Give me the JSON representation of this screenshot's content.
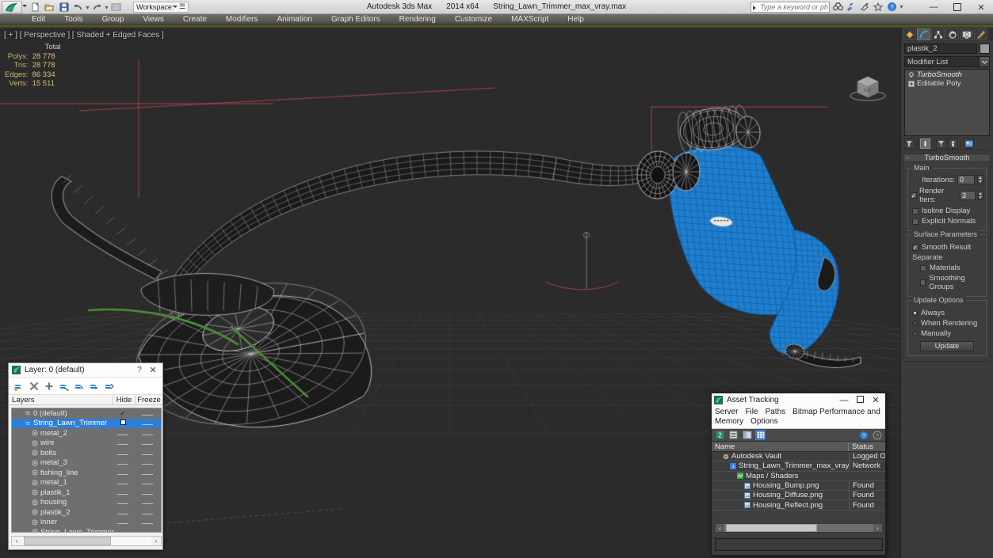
{
  "titlebar": {
    "app_title": "Autodesk 3ds Max",
    "version": "2014 x64",
    "file_name": "String_Lawn_Trimmer_max_vray.max",
    "workspace": "Workspace: Default",
    "search_placeholder": "Type a keyword or phrase",
    "quick_access": [
      "new-icon",
      "open-icon",
      "save-icon",
      "undo-icon",
      "redo-icon",
      "set-project-icon"
    ],
    "right_icons": [
      "binoculars-icon",
      "wrench-icon",
      "satellite-icon",
      "star-icon",
      "help-icon"
    ],
    "window_controls": {
      "minimize": "—",
      "maximize": "▫",
      "close": "✕"
    }
  },
  "menubar": {
    "items": [
      "Edit",
      "Tools",
      "Group",
      "Views",
      "Create",
      "Modifiers",
      "Animation",
      "Graph Editors",
      "Rendering",
      "Customize",
      "MAXScript",
      "Help"
    ]
  },
  "viewport": {
    "label": "[ + ] [ Perspective ] [ Shaded + Edged Faces ]",
    "stats": {
      "header": "Total",
      "rows": [
        {
          "label": "Polys:",
          "value": "28 778"
        },
        {
          "label": "Tris:",
          "value": "28 778"
        },
        {
          "label": "Edges:",
          "value": "86 334"
        },
        {
          "label": "Verts:",
          "value": "15 511"
        }
      ]
    },
    "viewcube_face": "TOP",
    "selection_color": "#1f7fd0",
    "background_color": "#2b2b2b"
  },
  "command_panel": {
    "tabs": [
      {
        "name": "create-tab",
        "icon": "create-icon",
        "active": false
      },
      {
        "name": "modify-tab",
        "icon": "modify-icon",
        "active": true
      },
      {
        "name": "hierarchy-tab",
        "icon": "hierarchy-icon",
        "active": false
      },
      {
        "name": "motion-tab",
        "icon": "motion-icon",
        "active": false
      },
      {
        "name": "display-tab",
        "icon": "display-icon",
        "active": false
      },
      {
        "name": "utilities-tab",
        "icon": "utilities-icon",
        "active": false
      }
    ],
    "object_name": "plastik_2",
    "object_color": "#9a9a9a",
    "modifier_list_label": "Modifier List",
    "stack": [
      {
        "label": "TurboSmooth",
        "italic": true
      },
      {
        "label": "Editable Poly",
        "italic": false
      }
    ],
    "rollout": {
      "title": "TurboSmooth",
      "main_group": "Main",
      "iterations_label": "Iterations:",
      "iterations_value": "0",
      "render_iters_label": "Render Iters:",
      "render_iters_value": "3",
      "render_iters_checked": true,
      "isoline_display": "Isoline Display",
      "isoline_checked": false,
      "explicit_normals": "Explicit Normals",
      "explicit_checked": false,
      "surface_group": "Surface Parameters",
      "smooth_result": "Smooth Result",
      "smooth_result_checked": true,
      "separate_label": "Separate",
      "materials": "Materials",
      "materials_checked": false,
      "smoothing_groups": "Smoothing Groups",
      "smoothing_groups_checked": false,
      "update_group": "Update Options",
      "update_options": [
        {
          "label": "Always",
          "selected": true
        },
        {
          "label": "When Rendering",
          "selected": false
        },
        {
          "label": "Manually",
          "selected": false
        }
      ],
      "update_button": "Update"
    }
  },
  "layer_dialog": {
    "title": "Layer: 0 (default)",
    "help_glyph": "?",
    "close_glyph": "✕",
    "toolbar_icons": [
      "new-layer-icon",
      "delete-layer-icon",
      "add-layer-icon",
      "select-objects-icon",
      "select-highlighted-icon",
      "highlight-selected-icon",
      "hide-layer-icon"
    ],
    "columns": {
      "name": "Layers",
      "hide": "Hide",
      "freeze": "Freeze"
    },
    "rows": [
      {
        "name": "0 (default)",
        "indent": 1,
        "icon": "layer-icon",
        "selected": false,
        "checkmark": true
      },
      {
        "name": "String_Lawn_Trimmer",
        "indent": 1,
        "icon": "layer-icon",
        "selected": true,
        "checkbox": true
      },
      {
        "name": "metal_2",
        "indent": 2,
        "icon": "object-icon",
        "selected": false
      },
      {
        "name": "wire",
        "indent": 2,
        "icon": "object-icon",
        "selected": false
      },
      {
        "name": "bolts",
        "indent": 2,
        "icon": "object-icon",
        "selected": false
      },
      {
        "name": "metal_3",
        "indent": 2,
        "icon": "object-icon",
        "selected": false
      },
      {
        "name": "fishing_line",
        "indent": 2,
        "icon": "object-icon",
        "selected": false
      },
      {
        "name": "metal_1",
        "indent": 2,
        "icon": "object-icon",
        "selected": false
      },
      {
        "name": "plastik_1",
        "indent": 2,
        "icon": "object-icon",
        "selected": false
      },
      {
        "name": "housing",
        "indent": 2,
        "icon": "object-icon",
        "selected": false
      },
      {
        "name": "plastik_2",
        "indent": 2,
        "icon": "object-icon",
        "selected": false
      },
      {
        "name": "inner",
        "indent": 2,
        "icon": "object-icon",
        "selected": false
      },
      {
        "name": "String_Lawn_Trimmer",
        "indent": 2,
        "icon": "object-icon",
        "selected": false
      }
    ]
  },
  "asset_dialog": {
    "title": "Asset Tracking",
    "window_controls": {
      "minimize": "—",
      "maximize": "▫",
      "close": "✕"
    },
    "menu": [
      "Server",
      "File",
      "Paths",
      "Bitmap Performance and Memory",
      "Options"
    ],
    "toolbar_icons": [
      "refresh-icon",
      "list-icon",
      "details-icon",
      "grid-icon"
    ],
    "right_icons": [
      "help-icon",
      "info-icon"
    ],
    "columns": {
      "name": "Name",
      "status": "Status"
    },
    "rows": [
      {
        "name": "Autodesk Vault",
        "status": "Logged O",
        "indent": 1,
        "icon": "vault-icon"
      },
      {
        "name": "String_Lawn_Trimmer_max_vray.max",
        "status": "Network ",
        "indent": 2,
        "icon": "maxfile-icon"
      },
      {
        "name": "Maps / Shaders",
        "status": "",
        "indent": 3,
        "icon": "maps-icon"
      },
      {
        "name": "Housing_Bump.png",
        "status": "Found",
        "indent": 4,
        "icon": "bitmap-icon"
      },
      {
        "name": "Housing_Diffuse.png",
        "status": "Found",
        "indent": 4,
        "icon": "bitmap-icon"
      },
      {
        "name": "Housing_Reflect.png",
        "status": "Found",
        "indent": 4,
        "icon": "bitmap-icon"
      }
    ]
  }
}
